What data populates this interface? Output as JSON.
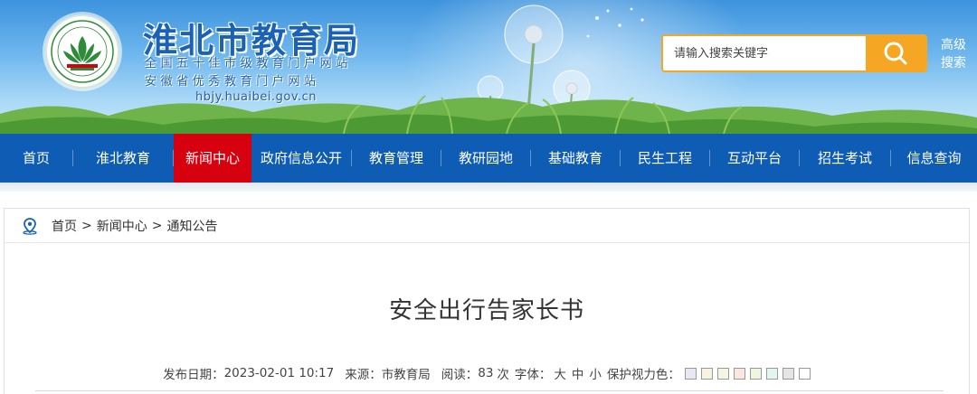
{
  "header": {
    "site_title": "淮北市教育局",
    "subtitle_1": "全国五十佳市级教育门户网站",
    "subtitle_2": "安徽省优秀教育门户网站",
    "domain": "hbjy.huaibei.gov.cn",
    "search_placeholder": "请输入搜索关键字",
    "advanced_search": "高级搜索"
  },
  "nav": {
    "items": [
      {
        "label": "首页"
      },
      {
        "label": "淮北教育"
      },
      {
        "label": "新闻中心",
        "active": true
      },
      {
        "label": "政府信息公开"
      },
      {
        "label": "教育管理"
      },
      {
        "label": "教研园地"
      },
      {
        "label": "基础教育"
      },
      {
        "label": "民生工程"
      },
      {
        "label": "互动平台"
      },
      {
        "label": "招生考试"
      },
      {
        "label": "信息查询"
      }
    ]
  },
  "breadcrumb": {
    "items": [
      "首页",
      "新闻中心",
      "通知公告"
    ],
    "separator": ">"
  },
  "article": {
    "title": "安全出行告家长书",
    "date_label": "发布日期：",
    "date": "2023-02-01 10:17",
    "source_label": "来源：",
    "source": "市教育局",
    "views_label": "阅读：",
    "views": "83",
    "views_unit": "次",
    "font_label": "字体：",
    "font_large": "大",
    "font_medium": "中",
    "font_small": "小",
    "eye_protect_label": "保护视力色："
  },
  "colors": {
    "nav_bg": "#0e5cb3",
    "nav_active": "#d7000f",
    "search_accent": "#f5a623",
    "title_blue": "#1b62b7",
    "eye_swatches": [
      "#e8e8f2",
      "#f7f3df",
      "#f2f6e3",
      "#fbe6e0",
      "#eef7dd",
      "#e2f6ef",
      "#e5e5e5",
      "#ffffff"
    ]
  }
}
